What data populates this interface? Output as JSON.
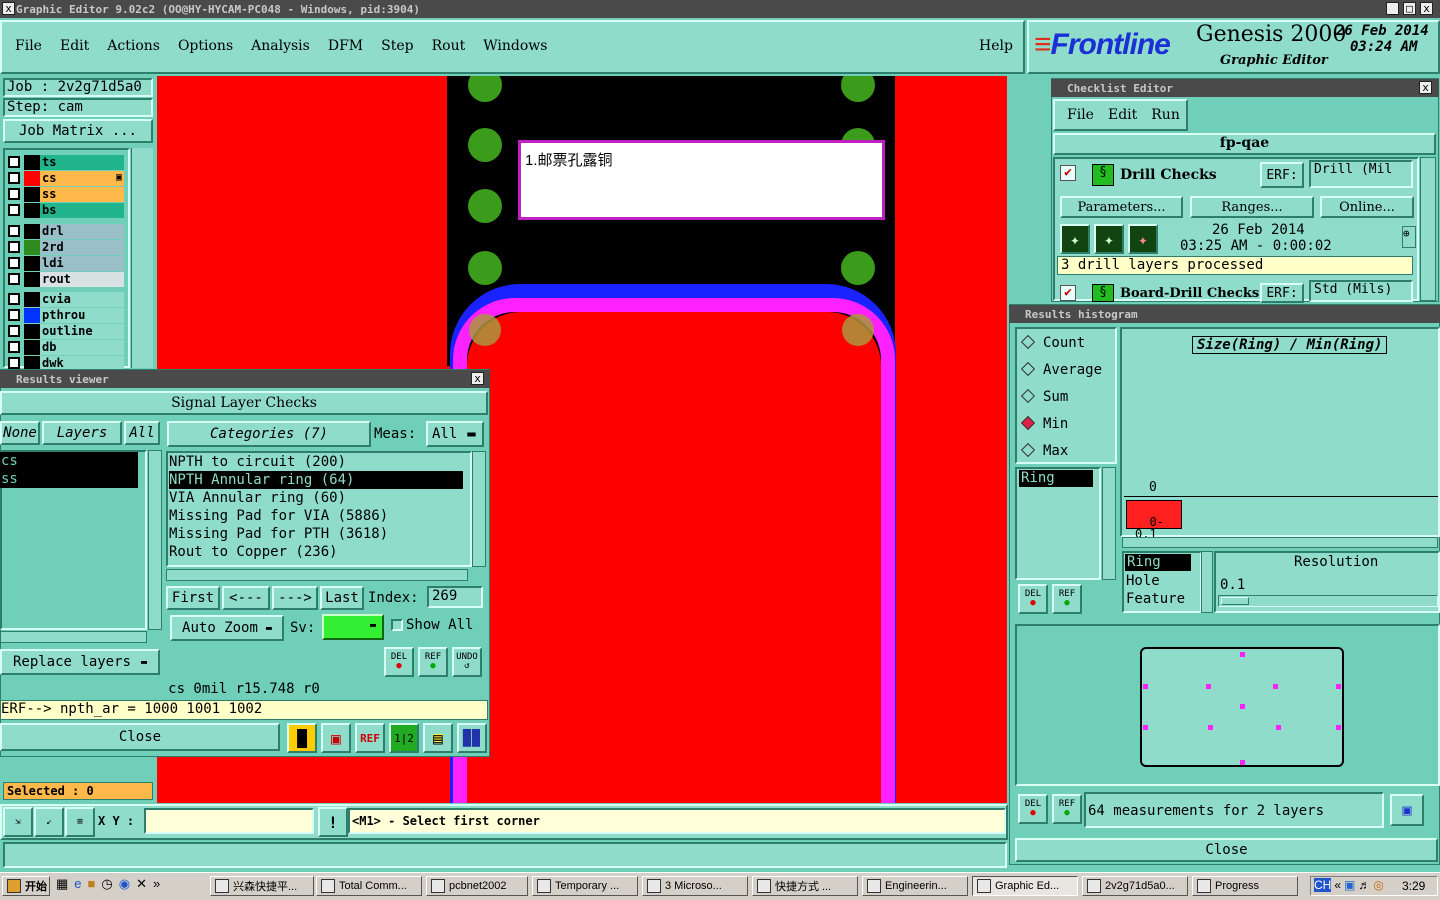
{
  "window": {
    "title": "Graphic Editor 9.02c2 (OO@HY-HYCAM-PC048 - Windows, pid:3904)"
  },
  "menu": [
    "File",
    "Edit",
    "Actions",
    "Options",
    "Analysis",
    "DFM",
    "Step",
    "Rout",
    "Windows"
  ],
  "help": "Help",
  "brand": {
    "logo": "Frontline",
    "product": "Genesis 2000",
    "sub": "Graphic Editor",
    "date": "26 Feb 2014",
    "time": "03:24 AM"
  },
  "job": {
    "job": "Job : 2v2g71d5a0",
    "step": "Step: cam",
    "matrix_btn": "Job Matrix ..."
  },
  "layers": {
    "group1": [
      {
        "name": "ts",
        "color": "#22b48c"
      },
      {
        "name": "cs",
        "color": "#ffb84a",
        "swatch": "#ff0000",
        "marker": "▣"
      },
      {
        "name": "ss",
        "color": "#ffb84a"
      },
      {
        "name": "bs",
        "color": "#22b48c"
      }
    ],
    "group2": [
      {
        "name": "drl",
        "color": "#99bfc8"
      },
      {
        "name": "2rd",
        "color": "#99bfc8",
        "swatch": "#2e8b1d"
      },
      {
        "name": "ldi",
        "color": "#99bfc8"
      },
      {
        "name": "rout",
        "color": "#d9e2e2"
      }
    ],
    "group3": [
      {
        "name": "cvia",
        "color": "#8fdcca"
      },
      {
        "name": "pthrou",
        "color": "#8fdcca",
        "swatch": "#0033ff"
      },
      {
        "name": "outline",
        "color": "#8fdcca"
      },
      {
        "name": "db",
        "color": "#8fdcca"
      },
      {
        "name": "dwk",
        "color": "#8fdcca"
      }
    ]
  },
  "selected": "Selected : 0",
  "bottom_bar": {
    "xy_label": "X Y :",
    "xy_value": "",
    "warn": "!",
    "hint": "<M1> - Select first corner"
  },
  "canvas": {
    "annotation": "1.邮票孔露铜"
  },
  "results_viewer": {
    "title": "Results viewer",
    "header": "Signal Layer Checks",
    "none": "None",
    "layers": "Layers",
    "all": "All",
    "categories": "Categories (7)",
    "meas_label": "Meas:",
    "meas_value": "All",
    "layer_list": [
      "cs",
      "ss"
    ],
    "categories_list": [
      "NPTH to circuit (200)",
      "NPTH Annular ring (64)",
      "VIA Annular ring (60)",
      "Missing Pad for VIA (5886)",
      "Missing Pad for PTH (3618)",
      "Rout to Copper (236)"
    ],
    "selected_category": 1,
    "nav": {
      "first": "First",
      "prev": "<---",
      "next": "--->",
      "last": "Last",
      "index_label": "Index:",
      "index_value": "269"
    },
    "auto_zoom": "Auto Zoom",
    "sv_label": "Sv:",
    "show_all": "Show All",
    "replace_layers": "Replace layers",
    "icons": {
      "del": "DEL",
      "ref": "REF",
      "undo": "UNDO"
    },
    "status": "cs 0mil  r15.748  r0",
    "erf": "ERF--> npth_ar = 1000 1001 1002",
    "close": "Close"
  },
  "checklist": {
    "title": "Checklist Editor",
    "menu": [
      "File",
      "Edit",
      "Run"
    ],
    "name": "fp-qae",
    "item1": {
      "label": "Drill Checks",
      "erf": "ERF:",
      "erf_value": "Drill (Mil"
    },
    "buttons": [
      "Parameters...",
      "Ranges...",
      "Online..."
    ],
    "run_date": "26 Feb 2014",
    "run_time": "03:25 AM - 0:00:02",
    "status": "3 drill layers processed",
    "item2": {
      "label": "Board-Drill Checks",
      "erf": "ERF:",
      "erf_value": "Std (Mils)"
    }
  },
  "histogram": {
    "title": "Results histogram",
    "modes": [
      "Count",
      "Average",
      "Sum",
      "Min",
      "Max"
    ],
    "selected_mode": "Min",
    "attr_list": [
      "Ring"
    ],
    "axis_title": "Size(Ring) / Min(Ring)",
    "axis_zero": "0",
    "bin_label": "0-\n0.1",
    "group_list": [
      "Ring",
      "Hole",
      "Feature"
    ],
    "resolution_label": "Resolution",
    "resolution_value": "0.1",
    "icons": {
      "del": "DEL",
      "ref": "REF"
    },
    "measurements": "64 measurements for 2 layers",
    "close": "Close"
  },
  "taskbar": {
    "start": "开始",
    "tasks": [
      "兴森快捷平...",
      "Total Comm...",
      "pcbnet2002",
      "Temporary ...",
      "3 Microso...",
      "快捷方式 ...",
      "Engineerin...",
      "Graphic Ed...",
      "2v2g71d5a0...",
      "Progress"
    ],
    "clock": "3:29"
  }
}
